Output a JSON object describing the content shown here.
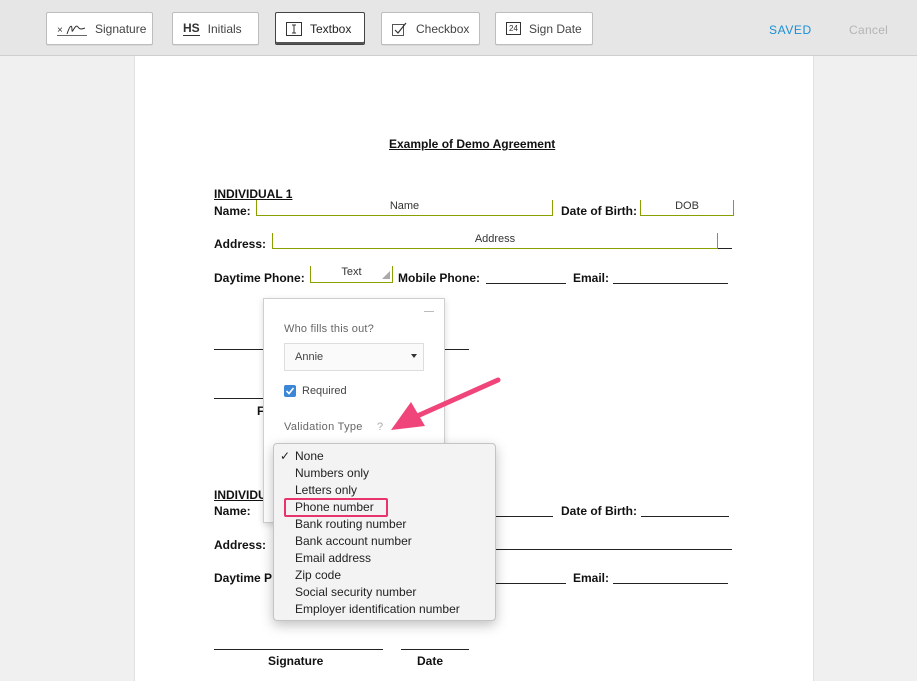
{
  "toolbar": {
    "signature_label": "Signature",
    "initials_label": "Initials",
    "initials_glyph": "HS",
    "textbox_label": "Textbox",
    "checkbox_label": "Checkbox",
    "signdate_label": "Sign Date",
    "signdate_glyph": "24",
    "saved_label": "SAVED",
    "cancel_label": "Cancel"
  },
  "document": {
    "title": "Example of Demo Agreement",
    "individual1": "INDIVIDUAL 1",
    "individual2_partial": "INDIVIDU",
    "name_label": "Name:",
    "dob_label": "Date of Birth:",
    "address_label": "Address:",
    "daytime_phone_label": "Daytime Phone:",
    "daytime_partial": "Daytime P",
    "mobile_phone_label": "Mobile Phone:",
    "email_label": "Email:",
    "signature_label": "Signature",
    "date_label": "Date",
    "partial_r": "F",
    "fields": {
      "name": "Name",
      "dob": "DOB",
      "address": "Address",
      "text": "Text"
    }
  },
  "popup": {
    "who_label": "Who fills this out?",
    "who_value": "Annie",
    "required_label": "Required",
    "required_checked": true,
    "validation_label": "Validation Type",
    "help_mark": "?"
  },
  "dropdown": {
    "selected": "None",
    "options": [
      "None",
      "Numbers only",
      "Letters only",
      "Phone number",
      "Bank routing number",
      "Bank account number",
      "Email address",
      "Zip code",
      "Social security number",
      "Employer identification number"
    ],
    "highlighted": "Phone number"
  },
  "colors": {
    "accent_blue": "#1a8fd6",
    "highlight_pink": "#e8336d",
    "field_green": "#8aa000"
  }
}
